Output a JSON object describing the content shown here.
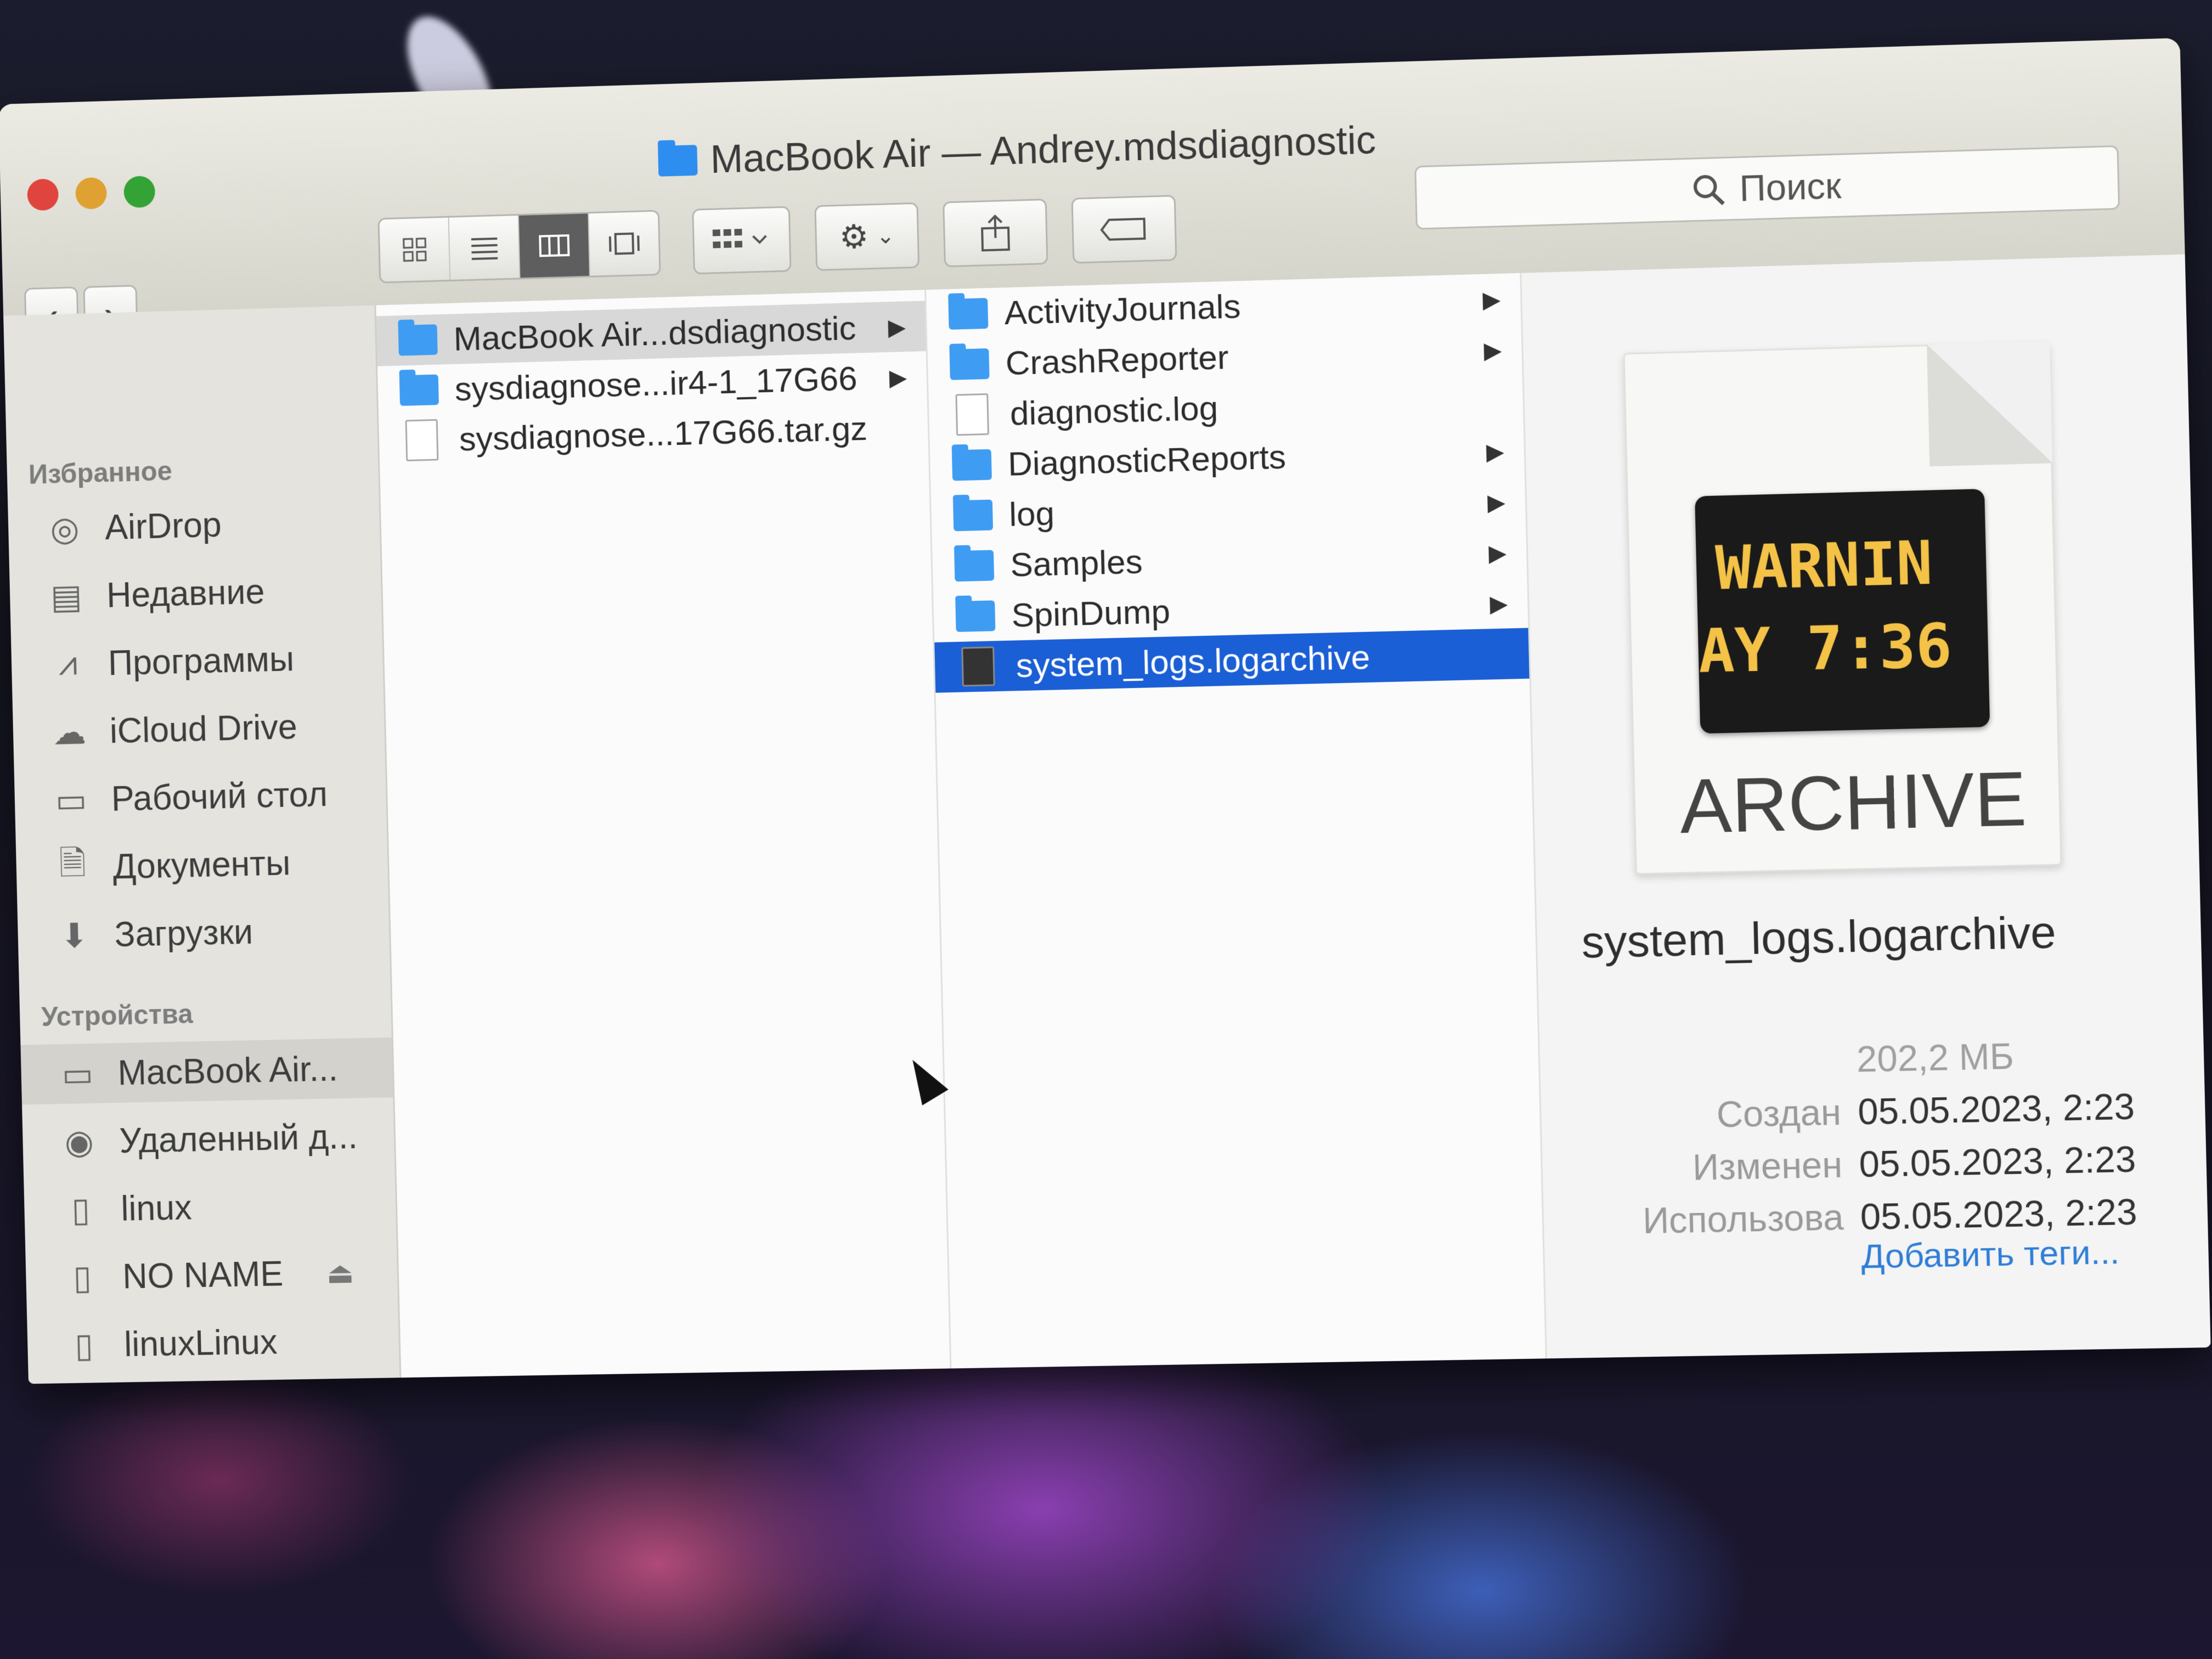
{
  "window": {
    "title": "MacBook Air — Andrey.mdsdiagnostic"
  },
  "toolbar": {
    "back_glyph": "‹",
    "forward_glyph": "›",
    "views": [
      "icon-view",
      "list-view",
      "column-view",
      "gallery-view"
    ],
    "active_view": "column-view",
    "search_label": "Поиск"
  },
  "sidebar": {
    "favorites_header": "Избранное",
    "favorites": [
      {
        "label": "AirDrop",
        "icon": "airdrop-icon"
      },
      {
        "label": "Недавние",
        "icon": "recents-icon"
      },
      {
        "label": "Программы",
        "icon": "applications-icon"
      },
      {
        "label": "iCloud Drive",
        "icon": "icloud-icon"
      },
      {
        "label": "Рабочий стол",
        "icon": "desktop-icon"
      },
      {
        "label": "Документы",
        "icon": "documents-icon"
      },
      {
        "label": "Загрузки",
        "icon": "downloads-icon"
      }
    ],
    "devices_header": "Устройства",
    "devices": [
      {
        "label": "MacBook Air...",
        "icon": "laptop-icon",
        "selected": true
      },
      {
        "label": "Удаленный д...",
        "icon": "remote-disc-icon"
      },
      {
        "label": "linux",
        "icon": "disk-icon"
      },
      {
        "label": "NO NAME",
        "icon": "disk-icon",
        "eject": true
      },
      {
        "label": "linuxLinux",
        "icon": "disk-icon"
      }
    ]
  },
  "column1": [
    {
      "label": "MacBook Air...dsdiagnostic",
      "type": "folder",
      "selected_parent": true,
      "has_children": true
    },
    {
      "label": "sysdiagnose...ir4-1_17G66",
      "type": "folder",
      "has_children": true
    },
    {
      "label": "sysdiagnose...17G66.tar.gz",
      "type": "archive-file"
    }
  ],
  "column2": [
    {
      "label": "ActivityJournals",
      "type": "folder",
      "has_children": true
    },
    {
      "label": "CrashReporter",
      "type": "folder",
      "has_children": true
    },
    {
      "label": "diagnostic.log",
      "type": "document"
    },
    {
      "label": "DiagnosticReports",
      "type": "folder",
      "has_children": true
    },
    {
      "label": "log",
      "type": "folder",
      "has_children": true
    },
    {
      "label": "Samples",
      "type": "folder",
      "has_children": true
    },
    {
      "label": "SpinDump",
      "type": "folder",
      "has_children": true
    },
    {
      "label": "system_logs.logarchive",
      "type": "logarchive",
      "selected": true
    }
  ],
  "preview": {
    "icon_line1": "WARNIN",
    "icon_line2": "AY 7:36",
    "icon_caption": "ARCHIVE",
    "file_name": "system_logs.logarchive",
    "size": "202,2 МБ",
    "created_label": "Создан",
    "created_value": "05.05.2023, 2:23",
    "modified_label": "Изменен",
    "modified_value": "05.05.2023, 2:23",
    "used_label": "Использова",
    "used_value": "05.05.2023, 2:23",
    "add_tags": "Добавить теги..."
  },
  "colors": {
    "selection": "#1b5fd6",
    "folder": "#3f9cf3",
    "link": "#2f7ed8"
  }
}
